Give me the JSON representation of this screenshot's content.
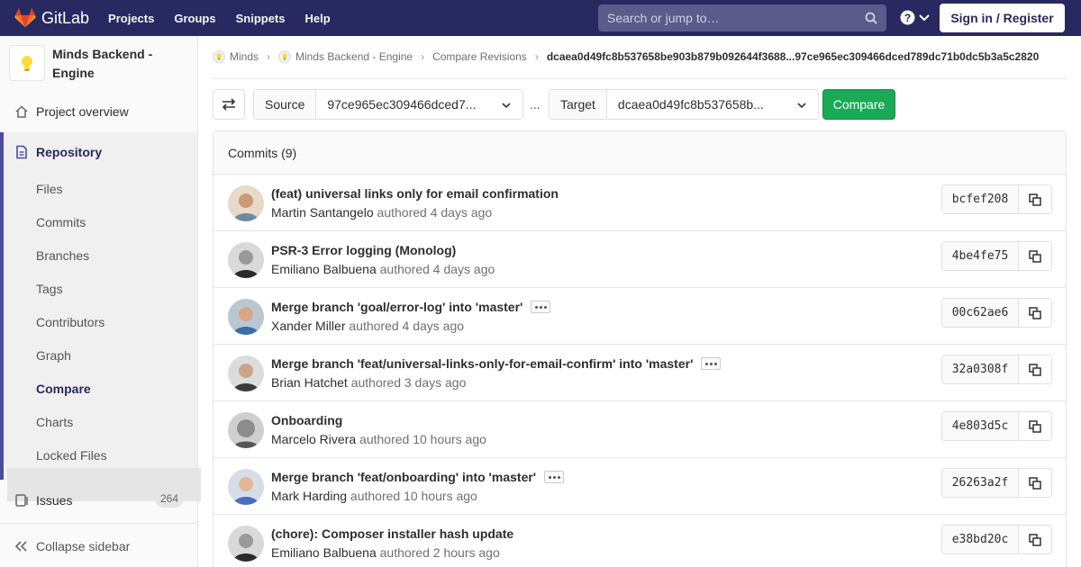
{
  "navbar": {
    "brand": "GitLab",
    "links": [
      "Projects",
      "Groups",
      "Snippets",
      "Help"
    ],
    "search_placeholder": "Search or jump to…",
    "signin": "Sign in / Register"
  },
  "sidebar": {
    "project_name": "Minds Backend - Engine",
    "overview": "Project overview",
    "repository": "Repository",
    "sub_items": [
      "Files",
      "Commits",
      "Branches",
      "Tags",
      "Contributors",
      "Graph",
      "Compare",
      "Charts",
      "Locked Files"
    ],
    "active_sub": "Compare",
    "issues": "Issues",
    "issues_count": "264",
    "collapse": "Collapse sidebar"
  },
  "breadcrumb": {
    "items": [
      "Minds",
      "Minds Backend - Engine",
      "Compare Revisions"
    ],
    "current": "dcaea0d49fc8b537658be903b879b092644f3688...97ce965ec309466dced789dc71b0dc5b3a5c2820"
  },
  "toolbar": {
    "source_label": "Source",
    "source_value": "97ce965ec309466dced7...",
    "dots": "...",
    "target_label": "Target",
    "target_value": "dcaea0d49fc8b537658b...",
    "compare_label": "Compare"
  },
  "commits": {
    "header": "Commits (9)",
    "rows": [
      {
        "title": "(feat) universal links only for email confirmation",
        "author": "Martin Santangelo",
        "time": "authored 4 days ago",
        "sha": "bcfef208",
        "more": false
      },
      {
        "title": "PSR-3 Error logging (Monolog)",
        "author": "Emiliano Balbuena",
        "time": "authored 4 days ago",
        "sha": "4be4fe75",
        "more": false
      },
      {
        "title": "Merge branch 'goal/error-log' into 'master'",
        "author": "Xander Miller",
        "time": "authored 4 days ago",
        "sha": "00c62ae6",
        "more": true
      },
      {
        "title": "Merge branch 'feat/universal-links-only-for-email-confirm' into 'master'",
        "author": "Brian Hatchet",
        "time": "authored 3 days ago",
        "sha": "32a0308f",
        "more": true
      },
      {
        "title": "Onboarding",
        "author": "Marcelo Rivera",
        "time": "authored 10 hours ago",
        "sha": "4e803d5c",
        "more": false
      },
      {
        "title": "Merge branch 'feat/onboarding' into 'master'",
        "author": "Mark Harding",
        "time": "authored 10 hours ago",
        "sha": "26263a2f",
        "more": true
      },
      {
        "title": "(chore): Composer installer hash update",
        "author": "Emiliano Balbuena",
        "time": "authored 2 hours ago",
        "sha": "e38bd20c",
        "more": false
      }
    ]
  },
  "colors": {
    "navbar": "#292961",
    "accent": "#4b4ba3",
    "compare_button": "#1aaa55"
  }
}
